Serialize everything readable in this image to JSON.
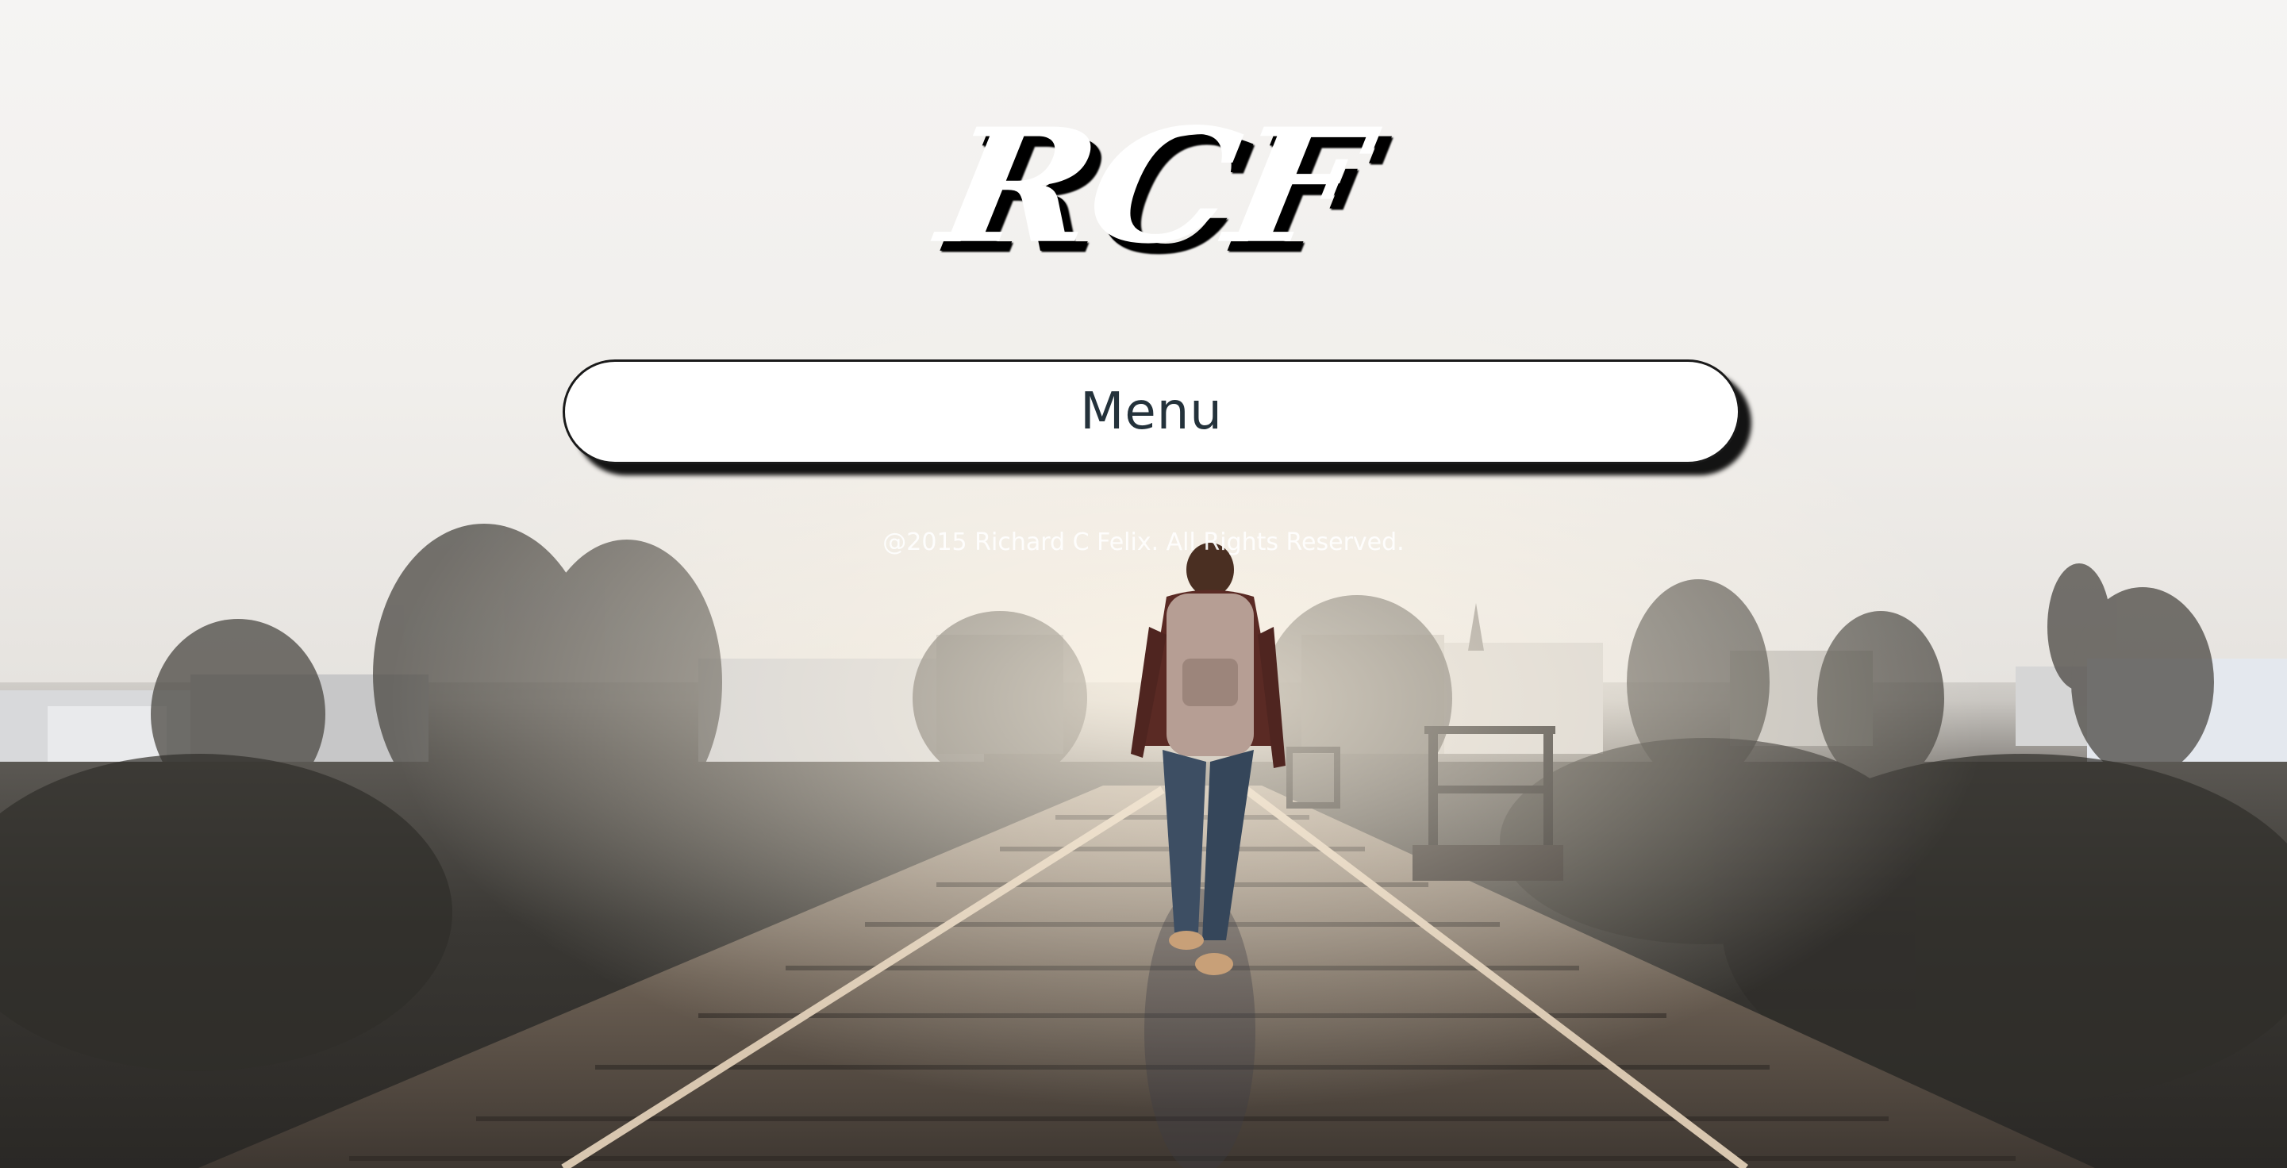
{
  "logo": {
    "text": "RCF"
  },
  "menu": {
    "label": "Menu"
  },
  "footer": {
    "copyright": "@2015 Richard C Felix. All Rights Reserved."
  },
  "colors": {
    "menu_text": "#24323b",
    "menu_background": "#ffffff",
    "logo_fill": "#ffffff",
    "logo_shadow": "#000000",
    "copyright_text": "#ffffff"
  }
}
